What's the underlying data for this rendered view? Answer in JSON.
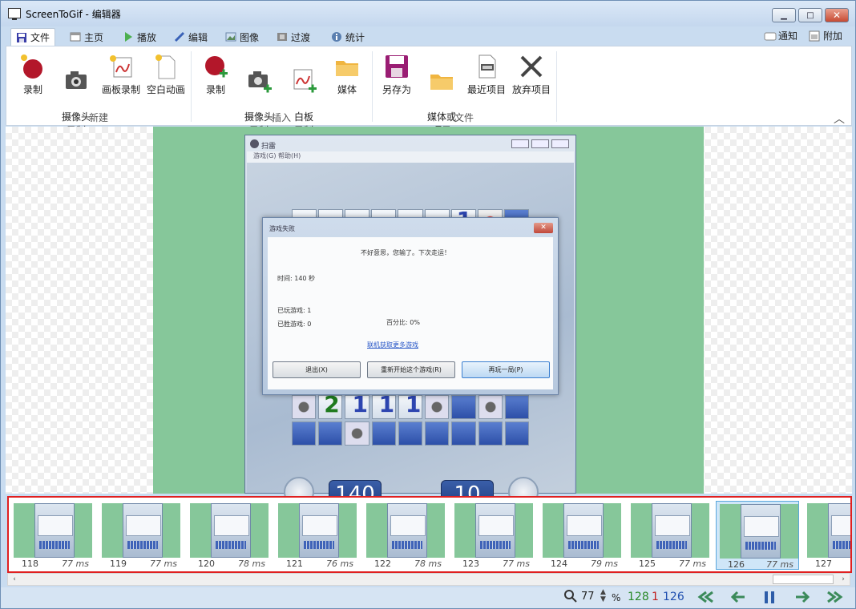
{
  "window": {
    "title": "ScreenToGif - 编辑器"
  },
  "tabs": [
    {
      "label": "文件",
      "icon": "save-icon"
    },
    {
      "label": "主页",
      "icon": "home-icon"
    },
    {
      "label": "播放",
      "icon": "play-icon"
    },
    {
      "label": "编辑",
      "icon": "pencil-icon"
    },
    {
      "label": "图像",
      "icon": "image-icon"
    },
    {
      "label": "过渡",
      "icon": "transition-icon"
    },
    {
      "label": "统计",
      "icon": "info-icon"
    }
  ],
  "right_tabs": {
    "notify": "通知",
    "extras": "附加"
  },
  "ribbon": {
    "new_group": {
      "label": "新建",
      "buttons": [
        "录制",
        "摄像头\n录制",
        "画板录制",
        "空白动画"
      ]
    },
    "insert_group": {
      "label": "插入",
      "buttons": [
        "录制",
        "摄像头\n录制",
        "白板\n录制",
        "媒体"
      ]
    },
    "file_group": {
      "label": "文件",
      "buttons": [
        "另存为",
        "媒体或\n项目",
        "最近项目",
        "放弃项目"
      ]
    }
  },
  "preview": {
    "game_title": "扫雷",
    "menu": "游戏(G)    帮助(H)",
    "digits_row1": "1",
    "digits_row2": [
      "2",
      "1",
      "1",
      "1"
    ],
    "time_counter": "140",
    "mine_counter": "10",
    "dialog": {
      "title": "游戏失败",
      "message": "不好意思，您输了。下次走运！",
      "time": "时间: 140 秒",
      "played": "已玩游戏: 1",
      "won": "已胜游戏: 0",
      "percent": "百分比: 0%",
      "link": "联机获取更多游戏",
      "btn_exit": "退出(X)",
      "btn_restart": "重新开始这个游戏(R)",
      "btn_again": "再玩一局(P)"
    }
  },
  "frames": [
    {
      "num": "118",
      "ms": "77 ms"
    },
    {
      "num": "119",
      "ms": "77 ms"
    },
    {
      "num": "120",
      "ms": "78 ms"
    },
    {
      "num": "121",
      "ms": "76 ms"
    },
    {
      "num": "122",
      "ms": "78 ms"
    },
    {
      "num": "123",
      "ms": "77 ms"
    },
    {
      "num": "124",
      "ms": "79 ms"
    },
    {
      "num": "125",
      "ms": "77 ms"
    },
    {
      "num": "126",
      "ms": "77 ms",
      "selected": true
    },
    {
      "num": "127",
      "ms": ""
    }
  ],
  "status": {
    "zoom": "77",
    "zoom_unit": "%",
    "frame_count": "128",
    "selected_count": "1",
    "current_frame": "126",
    "colors": {
      "count": "#2a8a2a",
      "selected": "#c02020",
      "current": "#2050b0"
    }
  }
}
